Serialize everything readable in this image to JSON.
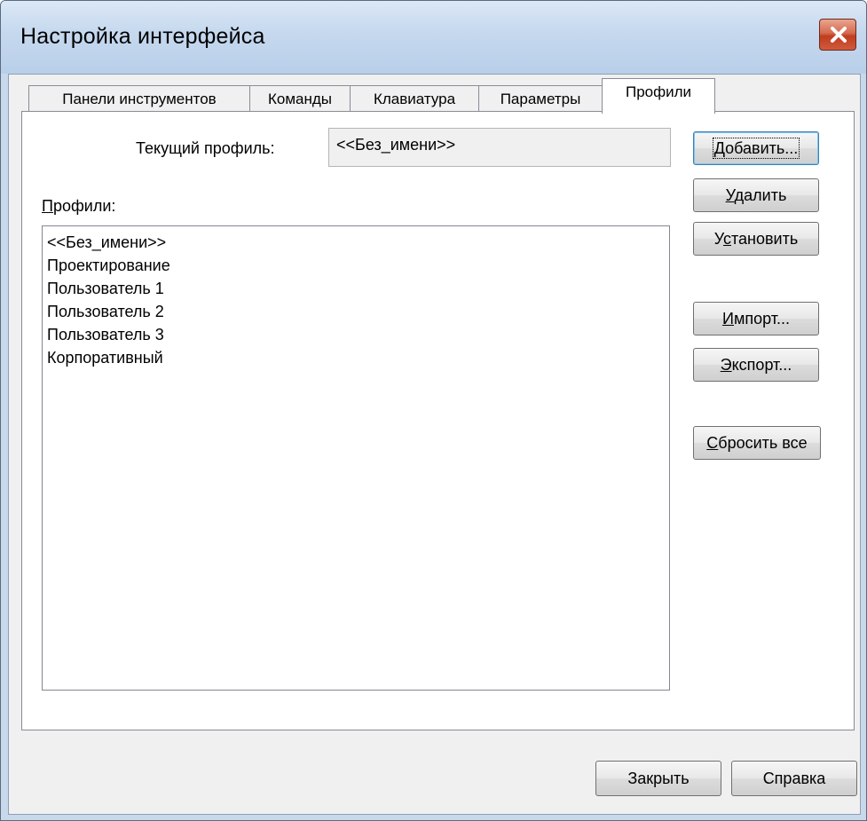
{
  "window": {
    "title": "Настройка интерфейса",
    "close_icon": "close-icon"
  },
  "tabs": [
    {
      "label": "Панели инструментов",
      "active": false
    },
    {
      "label": "Команды",
      "active": false
    },
    {
      "label": "Клавиатура",
      "active": false
    },
    {
      "label": "Параметры",
      "active": false
    },
    {
      "label": "Профили",
      "active": true
    }
  ],
  "profiles_tab": {
    "current_profile_label": "Текущий профиль:",
    "current_profile_value": "<<Без_имени>>",
    "profiles_label_accel": "П",
    "profiles_label_rest": "рофили:",
    "profiles": [
      "<<Без_имени>>",
      "Проектирование",
      "Пользователь 1",
      "Пользователь 2",
      "Пользователь 3",
      "Корпоративный"
    ],
    "buttons": {
      "add": {
        "accel": "Д",
        "rest": "обавить..."
      },
      "delete": {
        "accel": "У",
        "rest": "далить"
      },
      "set_pre": "У",
      "set_accel": "с",
      "set_rest": "тановить",
      "import": {
        "accel": "И",
        "rest": "мпорт..."
      },
      "export": {
        "accel": "Э",
        "rest": "кспорт..."
      },
      "reset": {
        "accel": "С",
        "rest": "бросить все"
      }
    }
  },
  "footer": {
    "close_label": "Закрыть",
    "help_label": "Справка"
  },
  "colors": {
    "titlebar": "#c5d8ee",
    "dialog_bg": "#f0f0f0",
    "close_button": "#c9472a"
  }
}
